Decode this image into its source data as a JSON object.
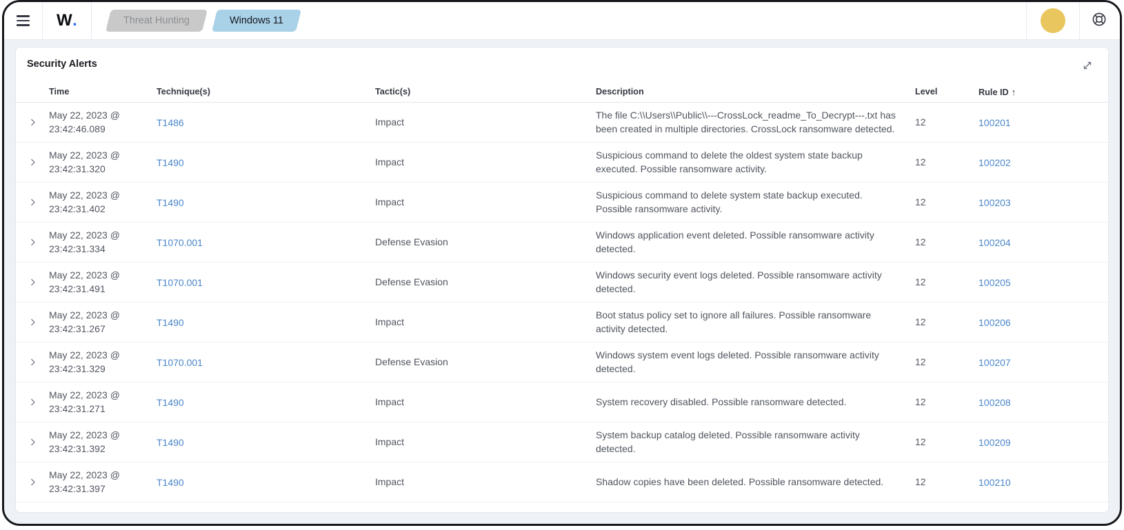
{
  "topbar": {
    "logo_w": "W",
    "logo_dot": ".",
    "breadcrumbs": [
      {
        "label": "Threat Hunting",
        "active": false
      },
      {
        "label": "Windows 11",
        "active": true
      }
    ]
  },
  "icons": {
    "sort_asc": "↑"
  },
  "colors": {
    "link_blue": "#4a86c8",
    "tab_active_bg": "#a9d1e8",
    "tab_inactive_bg": "#c9c9c9",
    "avatar_yellow": "#e9c75e",
    "page_bg": "#eef1f6"
  },
  "panel": {
    "title": "Security Alerts",
    "table": {
      "columns": [
        "Time",
        "Technique(s)",
        "Tactic(s)",
        "Description",
        "Level",
        "Rule ID"
      ],
      "sort_column": "Rule ID",
      "sort_direction": "asc",
      "rows": [
        {
          "time1": "May 22, 2023 @",
          "time2": "23:42:46.089",
          "technique": "T1486",
          "tactic": "Impact",
          "description": "The file C:\\\\Users\\\\Public\\\\---CrossLock_readme_To_Decrypt---.txt has been created in multiple directories. CrossLock ransomware detected.",
          "level": "12",
          "rule_id": "100201"
        },
        {
          "time1": "May 22, 2023 @",
          "time2": "23:42:31.320",
          "technique": "T1490",
          "tactic": "Impact",
          "description": "Suspicious command to delete the oldest system state backup executed. Possible ransomware activity.",
          "level": "12",
          "rule_id": "100202"
        },
        {
          "time1": "May 22, 2023 @",
          "time2": "23:42:31.402",
          "technique": "T1490",
          "tactic": "Impact",
          "description": "Suspicious command to delete system state backup executed. Possible ransomware activity.",
          "level": "12",
          "rule_id": "100203"
        },
        {
          "time1": "May 22, 2023 @",
          "time2": "23:42:31.334",
          "technique": "T1070.001",
          "tactic": "Defense Evasion",
          "description": "Windows application event deleted. Possible ransomware activity detected.",
          "level": "12",
          "rule_id": "100204"
        },
        {
          "time1": "May 22, 2023 @",
          "time2": "23:42:31.491",
          "technique": "T1070.001",
          "tactic": "Defense Evasion",
          "description": "Windows security event logs deleted. Possible ransomware activity detected.",
          "level": "12",
          "rule_id": "100205"
        },
        {
          "time1": "May 22, 2023 @",
          "time2": "23:42:31.267",
          "technique": "T1490",
          "tactic": "Impact",
          "description": "Boot status policy set to ignore all failures. Possible ransomware activity detected.",
          "level": "12",
          "rule_id": "100206"
        },
        {
          "time1": "May 22, 2023 @",
          "time2": "23:42:31.329",
          "technique": "T1070.001",
          "tactic": "Defense Evasion",
          "description": "Windows system event logs deleted. Possible ransomware activity detected.",
          "level": "12",
          "rule_id": "100207"
        },
        {
          "time1": "May 22, 2023 @",
          "time2": "23:42:31.271",
          "technique": "T1490",
          "tactic": "Impact",
          "description": "System recovery disabled. Possible ransomware detected.",
          "level": "12",
          "rule_id": "100208"
        },
        {
          "time1": "May 22, 2023 @",
          "time2": "23:42:31.392",
          "technique": "T1490",
          "tactic": "Impact",
          "description": "System backup catalog deleted. Possible ransomware activity detected.",
          "level": "12",
          "rule_id": "100209"
        },
        {
          "time1": "May 22, 2023 @",
          "time2": "23:42:31.397",
          "technique": "T1490",
          "tactic": "Impact",
          "description": "Shadow copies have been deleted. Possible ransomware detected.",
          "level": "12",
          "rule_id": "100210"
        }
      ]
    }
  }
}
